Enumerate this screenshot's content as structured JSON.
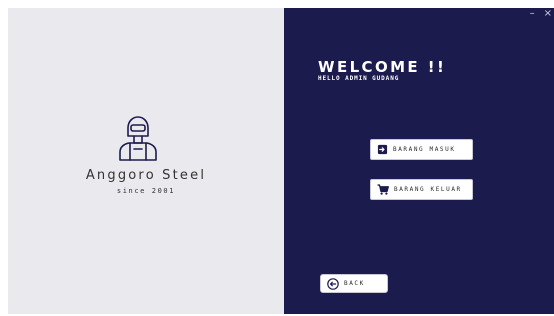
{
  "window": {
    "controls": {
      "minimize": "–",
      "close": "×"
    }
  },
  "branding": {
    "name": "Anggoro Steel",
    "since": "since 2001",
    "logo_icon": "welder-icon"
  },
  "welcome": {
    "title": "WELCOME !!",
    "subtitle": "HELLO ADMIN GUDANG"
  },
  "actions": {
    "masuk_label": "BARANG MASUK",
    "keluar_label": "BARANG KELUAR",
    "back_label": "BACK"
  },
  "colors": {
    "left_bg": "#e9e9ee",
    "right_bg": "#1c1b4d",
    "button_bg": "#ffffff"
  }
}
